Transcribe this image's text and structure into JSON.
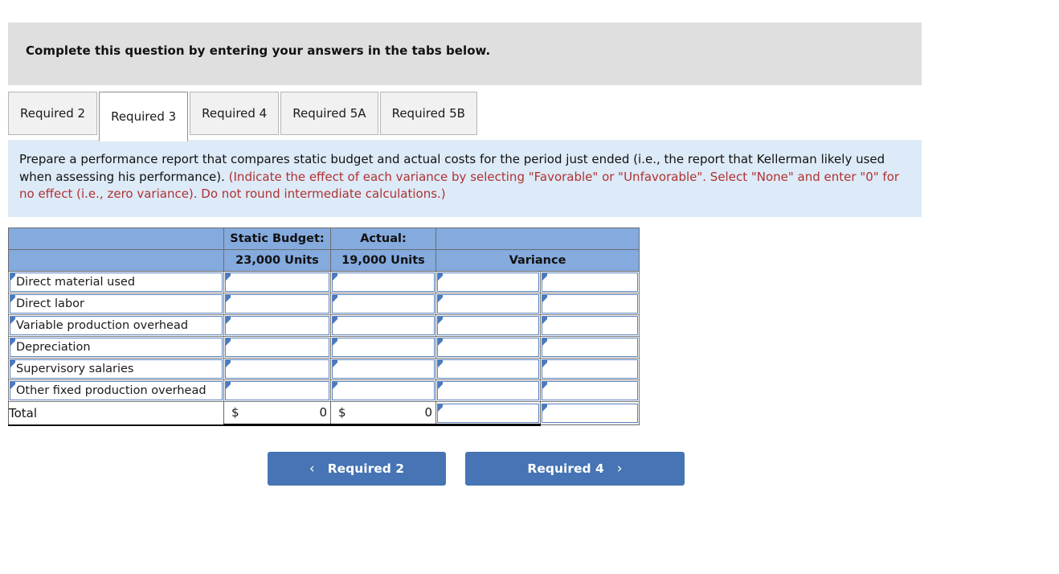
{
  "banner": {
    "text": "Complete this question by entering your answers in the tabs below."
  },
  "tabs": [
    {
      "label": "Required 2",
      "active": false
    },
    {
      "label": "Required 3",
      "active": true
    },
    {
      "label": "Required 4",
      "active": false
    },
    {
      "label": "Required 5A",
      "active": false
    },
    {
      "label": "Required 5B",
      "active": false
    }
  ],
  "instructions": {
    "main": "Prepare a performance report that compares static budget and actual costs for the period just ended (i.e., the report that Kellerman likely used when assessing his performance).",
    "hint": "(Indicate the effect of each variance by selecting \"Favorable\" or \"Unfavorable\". Select \"None\" and enter \"0\" for no effect (i.e., zero variance). Do not round intermediate calculations.)"
  },
  "table": {
    "header_row_1": {
      "label": "",
      "static_budget": "Static Budget:",
      "actual": "Actual:",
      "variance": ""
    },
    "header_row_2": {
      "label": "",
      "static_budget": "23,000 Units",
      "actual": "19,000 Units",
      "variance": "Variance"
    },
    "rows": [
      {
        "label": "Direct material used",
        "static_budget": "",
        "actual": "",
        "variance_amount": "",
        "variance_effect": ""
      },
      {
        "label": "Direct labor",
        "static_budget": "",
        "actual": "",
        "variance_amount": "",
        "variance_effect": ""
      },
      {
        "label": "Variable production overhead",
        "static_budget": "",
        "actual": "",
        "variance_amount": "",
        "variance_effect": ""
      },
      {
        "label": "Depreciation",
        "static_budget": "",
        "actual": "",
        "variance_amount": "",
        "variance_effect": ""
      },
      {
        "label": "Supervisory salaries",
        "static_budget": "",
        "actual": "",
        "variance_amount": "",
        "variance_effect": ""
      },
      {
        "label": "Other fixed production overhead",
        "static_budget": "",
        "actual": "",
        "variance_amount": "",
        "variance_effect": ""
      }
    ],
    "total": {
      "label": "Total",
      "currency": "$",
      "static_budget": "0",
      "actual": "0",
      "variance_amount": "",
      "variance_effect": ""
    }
  },
  "navigation": {
    "prev_label": "Required 2",
    "next_label": "Required 4",
    "prev_icon": "chevron-left-icon",
    "next_icon": "chevron-right-icon",
    "prev_glyph": "‹",
    "next_glyph": "›"
  },
  "colors": {
    "banner_bg": "#dfdfdf",
    "instructions_bg": "#ddeaf7",
    "hint_text": "#b03231",
    "table_header_bg": "#84aade",
    "cell_border": "#5b83be",
    "button_bg": "#4674b4"
  }
}
